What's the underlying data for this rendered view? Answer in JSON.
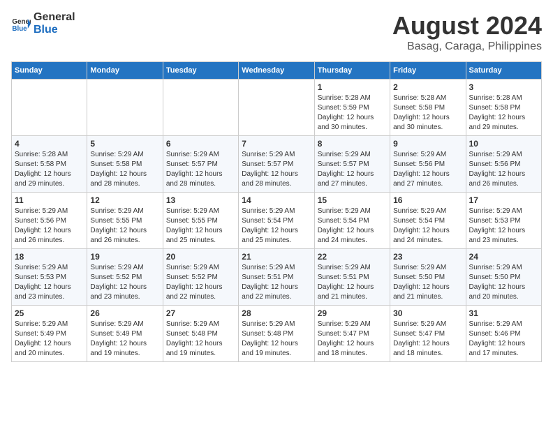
{
  "header": {
    "logo_general": "General",
    "logo_blue": "Blue",
    "title": "August 2024",
    "location": "Basag, Caraga, Philippines"
  },
  "days_of_week": [
    "Sunday",
    "Monday",
    "Tuesday",
    "Wednesday",
    "Thursday",
    "Friday",
    "Saturday"
  ],
  "weeks": [
    [
      {
        "day": "",
        "info": ""
      },
      {
        "day": "",
        "info": ""
      },
      {
        "day": "",
        "info": ""
      },
      {
        "day": "",
        "info": ""
      },
      {
        "day": "1",
        "info": "Sunrise: 5:28 AM\nSunset: 5:59 PM\nDaylight: 12 hours\nand 30 minutes."
      },
      {
        "day": "2",
        "info": "Sunrise: 5:28 AM\nSunset: 5:58 PM\nDaylight: 12 hours\nand 30 minutes."
      },
      {
        "day": "3",
        "info": "Sunrise: 5:28 AM\nSunset: 5:58 PM\nDaylight: 12 hours\nand 29 minutes."
      }
    ],
    [
      {
        "day": "4",
        "info": "Sunrise: 5:28 AM\nSunset: 5:58 PM\nDaylight: 12 hours\nand 29 minutes."
      },
      {
        "day": "5",
        "info": "Sunrise: 5:29 AM\nSunset: 5:58 PM\nDaylight: 12 hours\nand 28 minutes."
      },
      {
        "day": "6",
        "info": "Sunrise: 5:29 AM\nSunset: 5:57 PM\nDaylight: 12 hours\nand 28 minutes."
      },
      {
        "day": "7",
        "info": "Sunrise: 5:29 AM\nSunset: 5:57 PM\nDaylight: 12 hours\nand 28 minutes."
      },
      {
        "day": "8",
        "info": "Sunrise: 5:29 AM\nSunset: 5:57 PM\nDaylight: 12 hours\nand 27 minutes."
      },
      {
        "day": "9",
        "info": "Sunrise: 5:29 AM\nSunset: 5:56 PM\nDaylight: 12 hours\nand 27 minutes."
      },
      {
        "day": "10",
        "info": "Sunrise: 5:29 AM\nSunset: 5:56 PM\nDaylight: 12 hours\nand 26 minutes."
      }
    ],
    [
      {
        "day": "11",
        "info": "Sunrise: 5:29 AM\nSunset: 5:56 PM\nDaylight: 12 hours\nand 26 minutes."
      },
      {
        "day": "12",
        "info": "Sunrise: 5:29 AM\nSunset: 5:55 PM\nDaylight: 12 hours\nand 26 minutes."
      },
      {
        "day": "13",
        "info": "Sunrise: 5:29 AM\nSunset: 5:55 PM\nDaylight: 12 hours\nand 25 minutes."
      },
      {
        "day": "14",
        "info": "Sunrise: 5:29 AM\nSunset: 5:54 PM\nDaylight: 12 hours\nand 25 minutes."
      },
      {
        "day": "15",
        "info": "Sunrise: 5:29 AM\nSunset: 5:54 PM\nDaylight: 12 hours\nand 24 minutes."
      },
      {
        "day": "16",
        "info": "Sunrise: 5:29 AM\nSunset: 5:54 PM\nDaylight: 12 hours\nand 24 minutes."
      },
      {
        "day": "17",
        "info": "Sunrise: 5:29 AM\nSunset: 5:53 PM\nDaylight: 12 hours\nand 23 minutes."
      }
    ],
    [
      {
        "day": "18",
        "info": "Sunrise: 5:29 AM\nSunset: 5:53 PM\nDaylight: 12 hours\nand 23 minutes."
      },
      {
        "day": "19",
        "info": "Sunrise: 5:29 AM\nSunset: 5:52 PM\nDaylight: 12 hours\nand 23 minutes."
      },
      {
        "day": "20",
        "info": "Sunrise: 5:29 AM\nSunset: 5:52 PM\nDaylight: 12 hours\nand 22 minutes."
      },
      {
        "day": "21",
        "info": "Sunrise: 5:29 AM\nSunset: 5:51 PM\nDaylight: 12 hours\nand 22 minutes."
      },
      {
        "day": "22",
        "info": "Sunrise: 5:29 AM\nSunset: 5:51 PM\nDaylight: 12 hours\nand 21 minutes."
      },
      {
        "day": "23",
        "info": "Sunrise: 5:29 AM\nSunset: 5:50 PM\nDaylight: 12 hours\nand 21 minutes."
      },
      {
        "day": "24",
        "info": "Sunrise: 5:29 AM\nSunset: 5:50 PM\nDaylight: 12 hours\nand 20 minutes."
      }
    ],
    [
      {
        "day": "25",
        "info": "Sunrise: 5:29 AM\nSunset: 5:49 PM\nDaylight: 12 hours\nand 20 minutes."
      },
      {
        "day": "26",
        "info": "Sunrise: 5:29 AM\nSunset: 5:49 PM\nDaylight: 12 hours\nand 19 minutes."
      },
      {
        "day": "27",
        "info": "Sunrise: 5:29 AM\nSunset: 5:48 PM\nDaylight: 12 hours\nand 19 minutes."
      },
      {
        "day": "28",
        "info": "Sunrise: 5:29 AM\nSunset: 5:48 PM\nDaylight: 12 hours\nand 19 minutes."
      },
      {
        "day": "29",
        "info": "Sunrise: 5:29 AM\nSunset: 5:47 PM\nDaylight: 12 hours\nand 18 minutes."
      },
      {
        "day": "30",
        "info": "Sunrise: 5:29 AM\nSunset: 5:47 PM\nDaylight: 12 hours\nand 18 minutes."
      },
      {
        "day": "31",
        "info": "Sunrise: 5:29 AM\nSunset: 5:46 PM\nDaylight: 12 hours\nand 17 minutes."
      }
    ]
  ]
}
